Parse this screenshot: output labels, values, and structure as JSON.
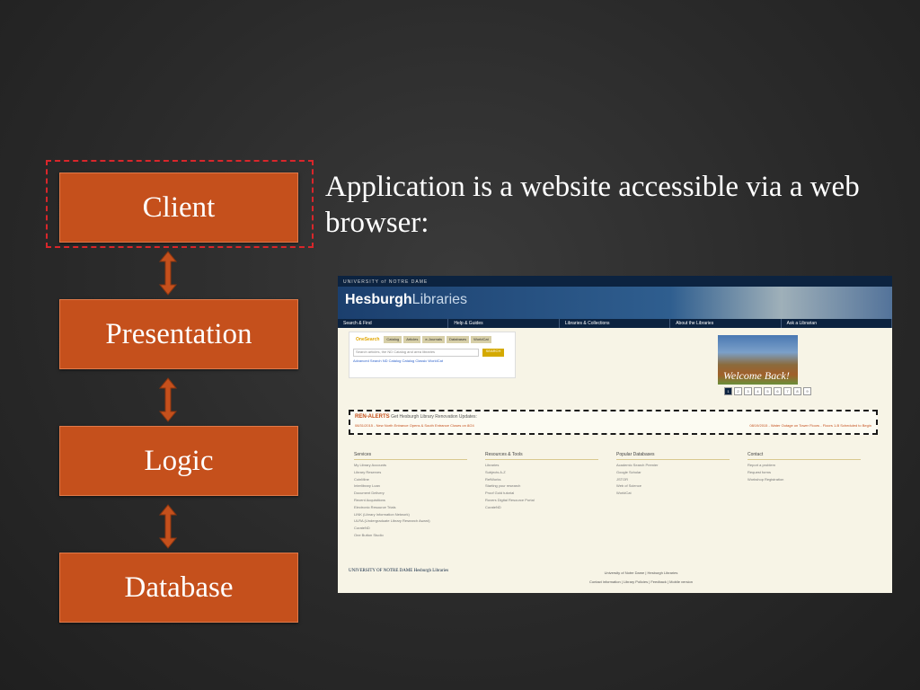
{
  "tiers": {
    "client": "Client",
    "presentation": "Presentation",
    "logic": "Logic",
    "database": "Database"
  },
  "description": "Application is a website accessible via a web browser:",
  "colors": {
    "tier_fill": "#c5501c",
    "highlight": "#d9262b",
    "arrow": "#c5501c",
    "background": "#2a2a2a"
  },
  "website": {
    "topbar": "UNIVERSITY of NOTRE DAME",
    "logo_main": "Hesburgh",
    "logo_sub": "Libraries",
    "nav": [
      "Search & Find",
      "Help & Guides",
      "Libraries & Collections",
      "About the Libraries",
      "Ask a Librarian"
    ],
    "search": {
      "tabs": [
        "OneSearch",
        "Catalog",
        "Articles",
        "e-Journals",
        "Databases",
        "WorldCat"
      ],
      "placeholder": "Search articles, the ND Catalog and area libraries",
      "button": "SEARCH",
      "links": "Advanced Search   ND Catalog   Catalog Classic   WorldCat"
    },
    "photo_caption": "Welcome Back!",
    "pager": [
      "1",
      "2",
      "3",
      "4",
      "5",
      "6",
      "7",
      "8",
      "9"
    ],
    "alerts": {
      "title": "REN-ALERTS",
      "subtitle": "Get Hesburgh Library Renovation Updates:",
      "item1": "08/31/2015 - New North Entrance Opens & South Entrance Closes on 8/24",
      "item2": "08/19/2015 - Water Outage on Tower Floors - Floors 1-B Scheduled to Begin"
    },
    "columns": [
      {
        "title": "Services",
        "items": [
          "My Library Accounts",
          "Library Reserves",
          "CoinMine",
          "Interlibrary Loan",
          "Document Delivery",
          "Recent Acquisitions",
          "Electronic Resource Trials",
          "LINK (Library Information Network)",
          "ULRA (Undergraduate Library Research Award)",
          "CurateND",
          "One Button Studio"
        ]
      },
      {
        "title": "Resources & Tools",
        "items": [
          "Libraries",
          "Subjects A-Z",
          "RefWorks",
          "Starting your research",
          "Proof Gold tutorial",
          "Rovers Digital Resource Portal",
          "CurateND"
        ]
      },
      {
        "title": "Popular Databases",
        "items": [
          "Academic Search Premier",
          "Google Scholar",
          "JSTOR",
          "Web of Science",
          "WorldCat"
        ]
      },
      {
        "title": "Contact",
        "items": [
          "Report a problem",
          "Request forms",
          "Workshop Registration"
        ]
      }
    ],
    "footer_logo": "UNIVERSITY OF NOTRE DAME Hesburgh Libraries",
    "footer_line1": "University of Notre Dame | Hesburgh Libraries",
    "footer_line2": "Contact information | Library Policies | Feedback | Mobile version"
  }
}
